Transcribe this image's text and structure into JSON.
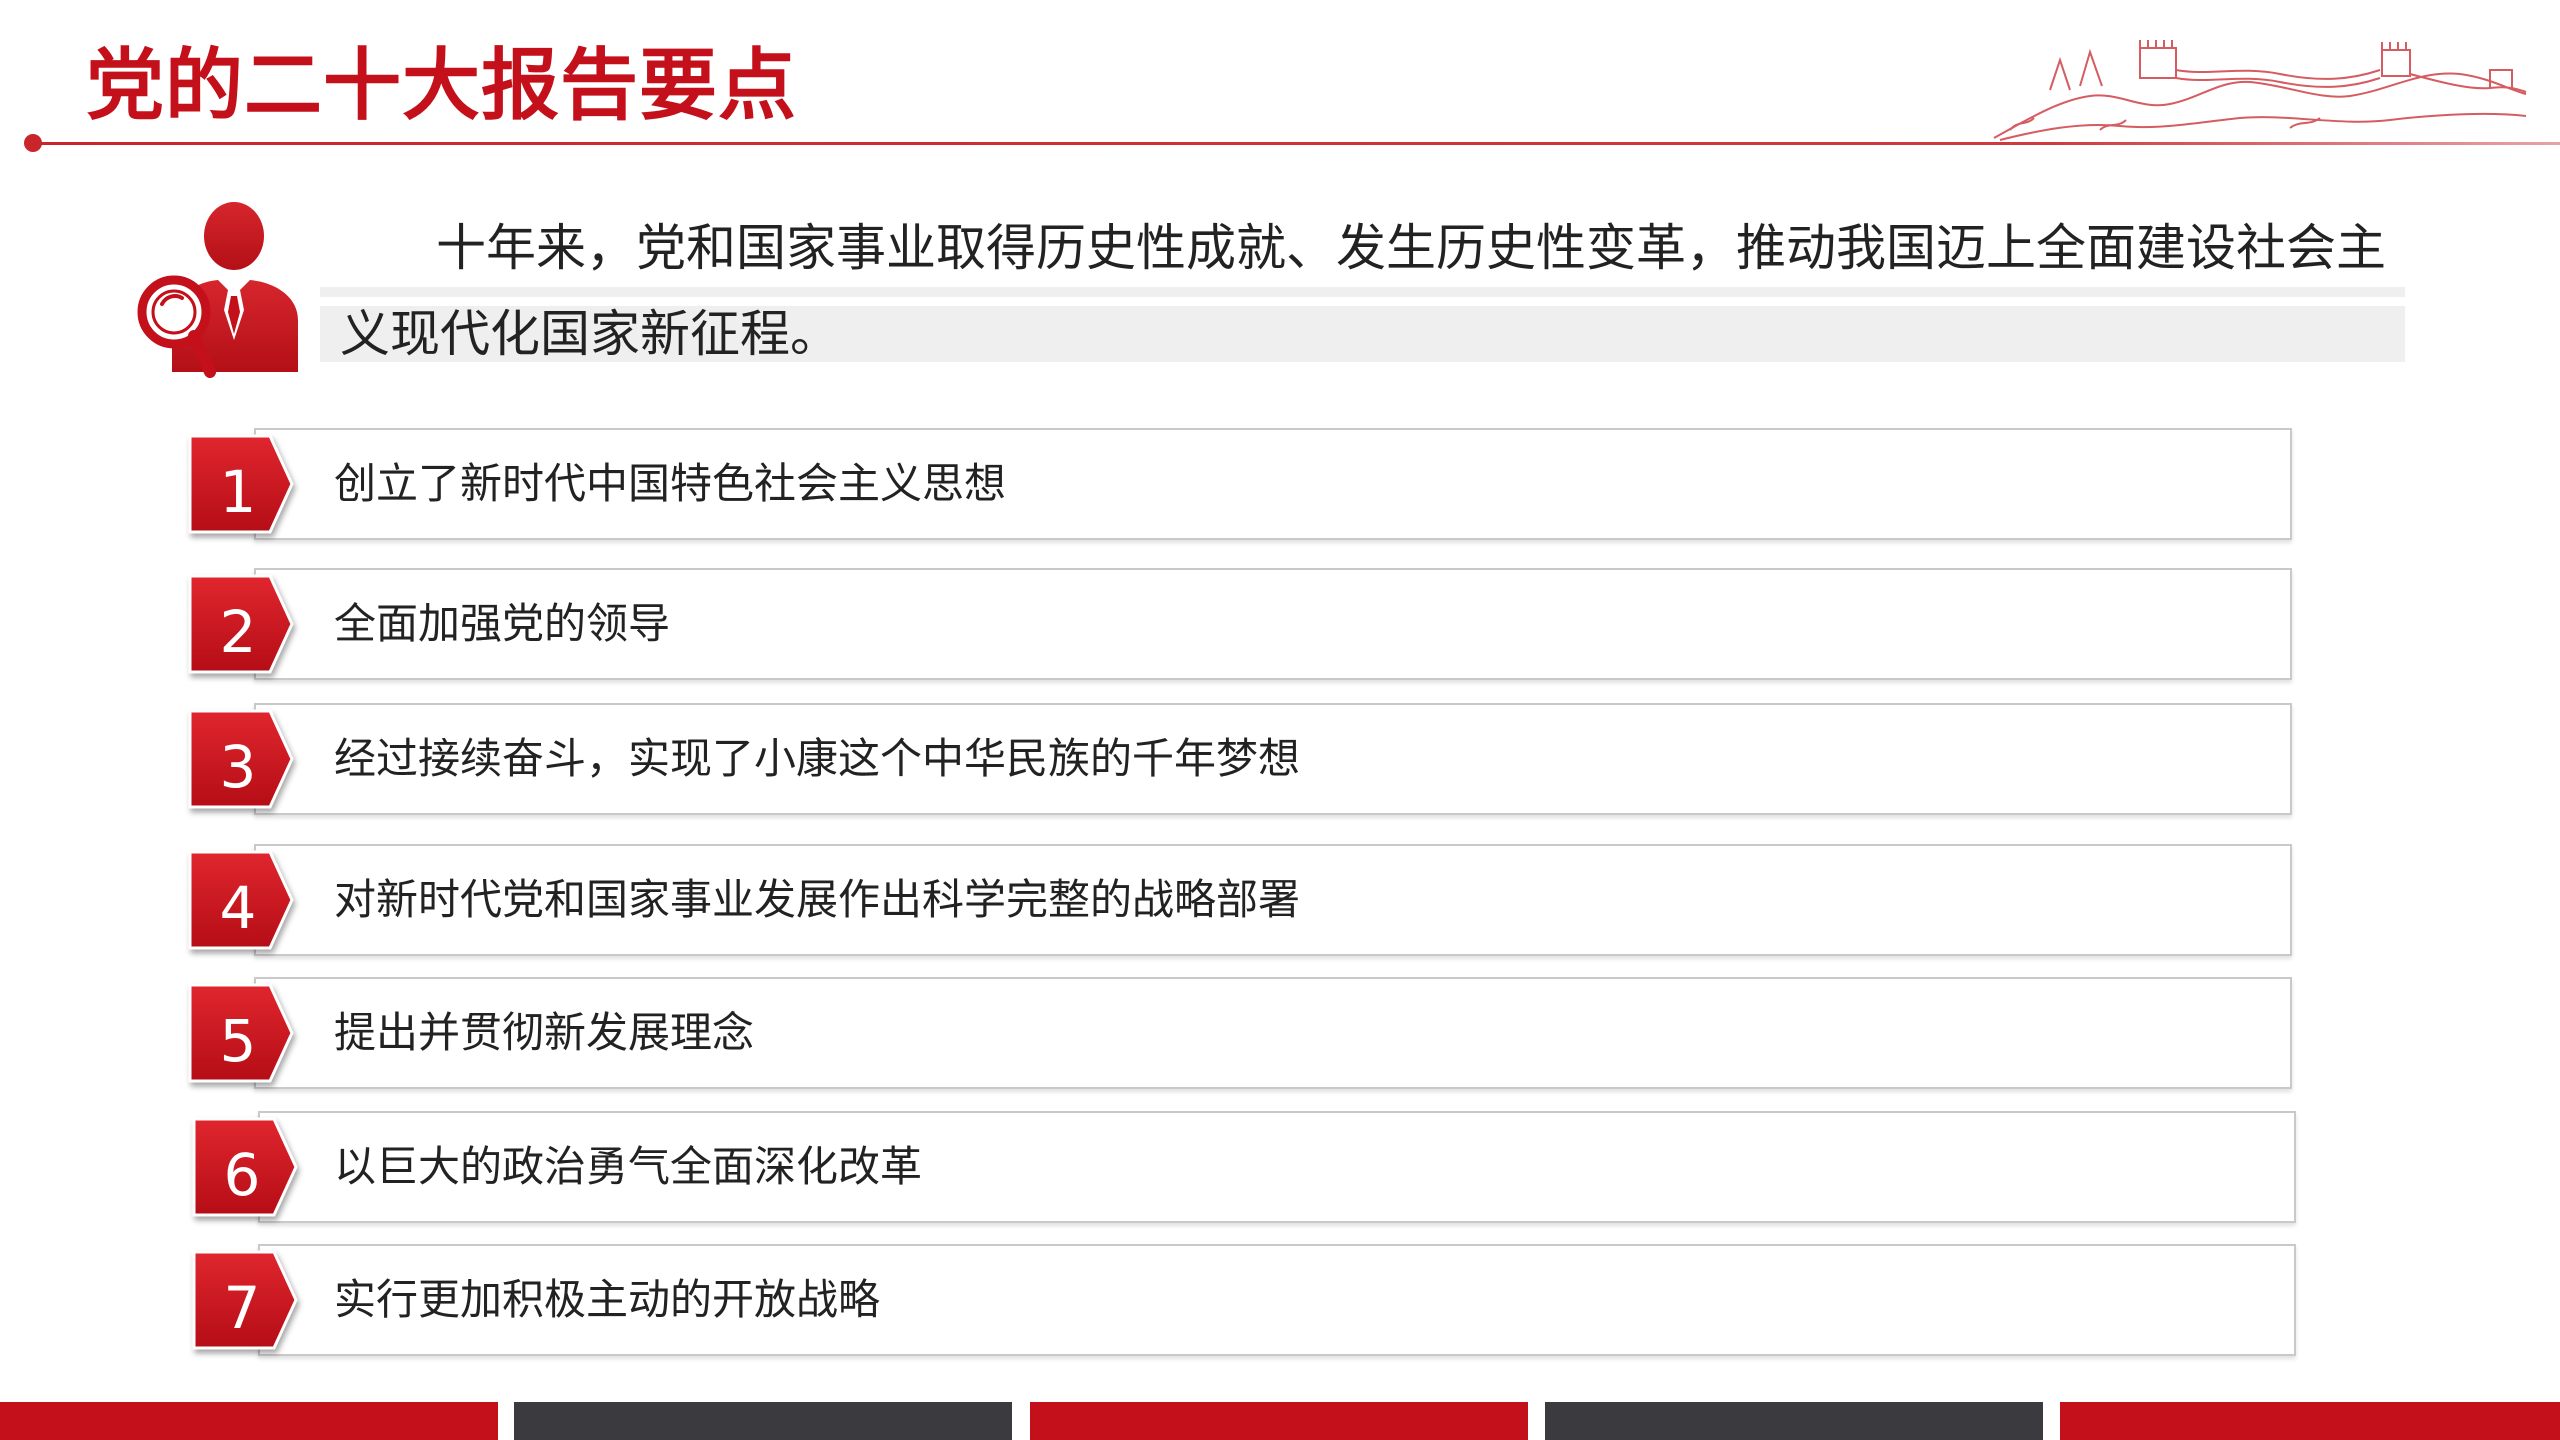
{
  "header": {
    "title": "党的二十大报告要点"
  },
  "intro": {
    "text": "十年来，党和国家事业取得历史性成就、发生历史性变革，推动我国迈上全面建设社会主义现代化国家新征程。"
  },
  "items": [
    {
      "num": "1",
      "label": "创立了新时代中国特色社会主义思想"
    },
    {
      "num": "2",
      "label": "全面加强党的领导"
    },
    {
      "num": "3",
      "label": "经过接续奋斗，实现了小康这个中华民族的千年梦想"
    },
    {
      "num": "4",
      "label": "对新时代党和国家事业发展作出科学完整的战略部署"
    },
    {
      "num": "5",
      "label": "提出并贯彻新发展理念"
    },
    {
      "num": "6",
      "label": "以巨大的政治勇气全面深化改革"
    },
    {
      "num": "7",
      "label": "实行更加积极主动的开放战略"
    }
  ],
  "colors": {
    "accent_red": "#c3101a",
    "badge_red_light": "#e0262e",
    "badge_red_dark": "#b50d16",
    "bar_dark": "#3a3a3f",
    "border_gray": "#c9c9c9"
  },
  "icons": {
    "person": "person-with-magnifier-icon",
    "wall": "great-wall-decoration"
  }
}
